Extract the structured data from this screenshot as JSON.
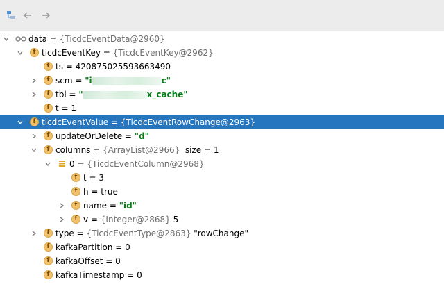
{
  "toolbar": {
    "icons": [
      "tree-icon",
      "back-arrow-icon",
      "forward-arrow-icon"
    ]
  },
  "tree": {
    "root": {
      "name": "data",
      "ref": "{TicdcEventData@2960}"
    },
    "ticdcEventKey": {
      "name": "ticdcEventKey",
      "ref": "{TicdcEventKey@2962}"
    },
    "ts": {
      "text": "ts = 420875025593663490"
    },
    "scm": {
      "name": "scm = ",
      "value_start": "\"i",
      "value_end": "c\""
    },
    "tbl": {
      "name": "tbl = ",
      "value_start": "\"",
      "value_end": "x_cache\""
    },
    "t_key": {
      "text": "t = 1"
    },
    "ticdcEventValue": {
      "name": "ticdcEventValue",
      "ref": "{TicdcEventRowChange@2963}"
    },
    "updateOrDelete": {
      "name": "updateOrDelete = ",
      "value": "\"d\""
    },
    "columns": {
      "name": "columns",
      "ref": "{ArrayList@2966}",
      "size": "size = 1"
    },
    "col0": {
      "name": "0",
      "ref": "{TicdcEventColumn@2968}"
    },
    "col_t": {
      "text": "t = 3"
    },
    "col_h": {
      "text": "h = true"
    },
    "col_name": {
      "name": "name = ",
      "value": "\"id\""
    },
    "col_v": {
      "name": "v",
      "ref": "{Integer@2868}",
      "value": "5"
    },
    "type": {
      "name": "type",
      "ref": "{TicdcEventType@2863}",
      "value": "\"rowChange\""
    },
    "kafkaPartition": {
      "text": "kafkaPartition = 0"
    },
    "kafkaOffset": {
      "text": "kafkaOffset = 0"
    },
    "kafkaTimestamp": {
      "text": "kafkaTimestamp = 0"
    }
  },
  "colors": {
    "selected": "#2675bf",
    "string": "#067d17",
    "field_icon": "#f1c26b"
  }
}
